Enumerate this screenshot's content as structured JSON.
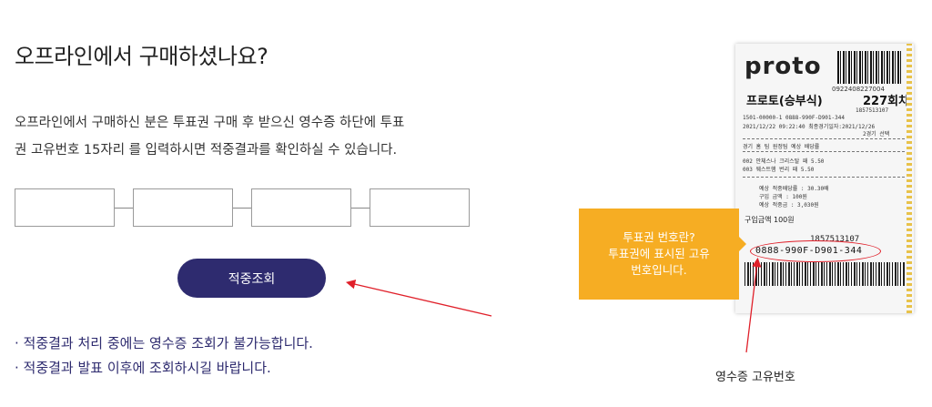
{
  "page": {
    "title": "오프라인에서 구매하셨나요?",
    "description_line1": "오프라인에서 구매하신 분은 투표권 구매 후 받으신 영수증 하단에 투표",
    "description_line2": "권 고유번호 15자리 를 입력하시면 적중결과를 확인하실 수 있습니다."
  },
  "form": {
    "fields": [
      "",
      "",
      "",
      ""
    ],
    "submit_label": "적중조회"
  },
  "notes": [
    "· 적중결과 처리 중에는 영수증 조회가 불가능합니다.",
    "· 적중결과 발표 이후에 조회하시길 바랍니다."
  ],
  "receipt": {
    "logo": "proto",
    "serial_top": "0922408227004",
    "game_title": "프로토(승부식)",
    "round": "227회차",
    "line_a": "1857513107",
    "line_b": "1501-00000-1          0888-990F-D901-344",
    "line_c": "2021/12/22 09:22:40   최종경기일자:2021/12/26",
    "line_d": "2경기 선택",
    "col_headers": "경기  홈 팀        원정팀    예상   배당률",
    "row1": "002 안체스나      크리스탈   패     5.50",
    "row2": "003 웨스트햄      번리       패     5.50",
    "sum1": "예상 적중배당률 :        30.30배",
    "sum2": "구입 금액 :              100원",
    "sum3": "예상 적중금 :          3,030원",
    "amount": "구입금액 100원",
    "number_small": "1857513107",
    "unique_id": "0888-990F-D901-344"
  },
  "tooltip": {
    "line1": "투표권 번호란?",
    "line2": "투표권에 표시된 고유",
    "line3": "번호입니다."
  },
  "caption": "영수증 고유번호",
  "colors": {
    "button": "#2e2b6f",
    "notes_text": "#2e2b6f",
    "tooltip_bg": "#f6ad23",
    "annotation_red": "#e0202a"
  }
}
